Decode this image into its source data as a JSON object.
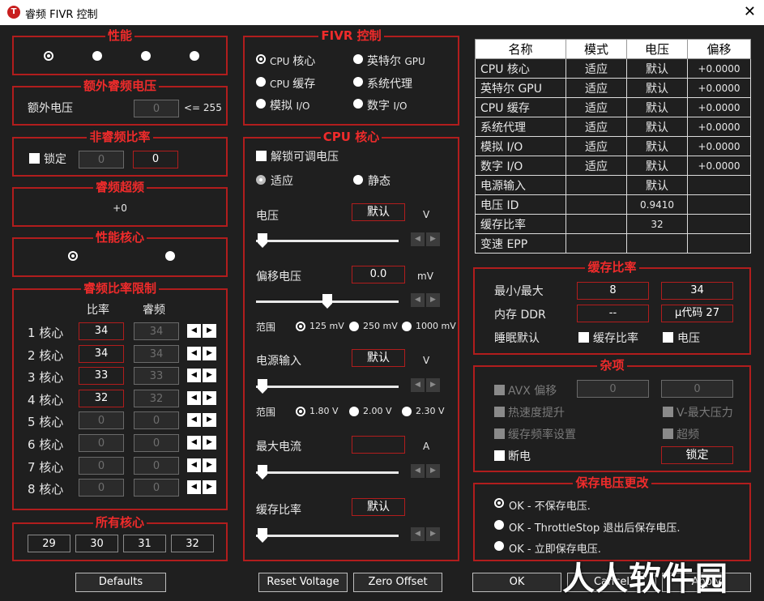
{
  "window": {
    "title": "睿频 FIVR 控制",
    "icon_letter": "T",
    "close_glyph": "✕"
  },
  "performance": {
    "title": "性能"
  },
  "extra_turbo_voltage": {
    "title": "额外睿频电压",
    "label": "额外电压",
    "value": "0",
    "limit": "<= 255"
  },
  "non_turbo_ratio": {
    "title": "非睿频比率",
    "lock_label": "锁定",
    "value1": "0",
    "value2": "0"
  },
  "turbo_boost": {
    "title": "睿频超频",
    "value": "+0"
  },
  "perf_core": {
    "title": "性能核心"
  },
  "turbo_ratio_limit": {
    "title": "睿频比率限制",
    "col_ratio": "比率",
    "col_turbo": "睿频",
    "rows": [
      {
        "label": "1 核心",
        "ratio": "34",
        "turbo": "34"
      },
      {
        "label": "2 核心",
        "ratio": "34",
        "turbo": "34"
      },
      {
        "label": "3 核心",
        "ratio": "33",
        "turbo": "33"
      },
      {
        "label": "4 核心",
        "ratio": "32",
        "turbo": "32"
      },
      {
        "label": "5 核心",
        "ratio": "0",
        "turbo": "0"
      },
      {
        "label": "6 核心",
        "ratio": "0",
        "turbo": "0"
      },
      {
        "label": "7 核心",
        "ratio": "0",
        "turbo": "0"
      },
      {
        "label": "8 核心",
        "ratio": "0",
        "turbo": "0"
      }
    ]
  },
  "all_cores": {
    "title": "所有核心",
    "values": [
      "29",
      "30",
      "31",
      "32"
    ]
  },
  "fivr_control": {
    "title": "FIVR 控制",
    "options": [
      {
        "main": "CPU ",
        "sub": "核心"
      },
      {
        "main": "英特尔 ",
        "sub": "GPU"
      },
      {
        "main": "CPU ",
        "sub": "缓存"
      },
      {
        "main": "系统代理",
        "sub": ""
      },
      {
        "main": "模拟 ",
        "sub": "I/O"
      },
      {
        "main": "数字 ",
        "sub": "I/O"
      }
    ]
  },
  "cpu_core": {
    "title": "CPU 核心",
    "unlock_label": "解锁可调电压",
    "adaptive_label": "适应",
    "static_label": "静态",
    "voltage": {
      "label": "电压",
      "value": "默认",
      "unit": "V",
      "slider_level": 0
    },
    "offset": {
      "label": "偏移电压",
      "value": "0.0",
      "unit": "mV",
      "slider_level": 0.5,
      "range_label": "范围",
      "ranges": [
        "125 mV",
        "250 mV",
        "1000 mV"
      ]
    },
    "power_input": {
      "label": "电源输入",
      "value": "默认",
      "unit": "V",
      "slider_level": 0,
      "range_label": "范围",
      "ranges": [
        "1.80 V",
        "2.00 V",
        "2.30 V"
      ]
    },
    "max_current": {
      "label": "最大电流",
      "value": "",
      "unit": "A",
      "slider_level": 0
    },
    "cache_ratio": {
      "label": "缓存比率",
      "value": "默认",
      "slider_level": 0
    }
  },
  "fivr_table": {
    "headers": [
      "名称",
      "模式",
      "电压",
      "偏移"
    ],
    "rows": [
      {
        "name": "CPU 核心",
        "mode": "适应",
        "voltage": "默认",
        "offset": "+0.0000"
      },
      {
        "name": "英特尔 GPU",
        "mode": "适应",
        "voltage": "默认",
        "offset": "+0.0000"
      },
      {
        "name": "CPU 缓存",
        "mode": "适应",
        "voltage": "默认",
        "offset": "+0.0000"
      },
      {
        "name": "系统代理",
        "mode": "适应",
        "voltage": "默认",
        "offset": "+0.0000"
      },
      {
        "name": "模拟 I/O",
        "mode": "适应",
        "voltage": "默认",
        "offset": "+0.0000"
      },
      {
        "name": "数字 I/O",
        "mode": "适应",
        "voltage": "默认",
        "offset": "+0.0000"
      },
      {
        "name": "电源输入",
        "mode": "",
        "voltage": "默认",
        "offset": ""
      },
      {
        "name": "电压 ID",
        "mode": "",
        "voltage": "0.9410",
        "offset": ""
      },
      {
        "name": "缓存比率",
        "mode": "",
        "voltage": "32",
        "offset": ""
      },
      {
        "name": "变速 EPP",
        "mode": "",
        "voltage": "",
        "offset": ""
      }
    ]
  },
  "cache_ratio_group": {
    "title": "缓存比率",
    "min_max_label": "最小/最大",
    "min_value": "8",
    "max_value": "34",
    "memory_label": "内存 DDR",
    "memory_value": "--",
    "microcode": "μ代码 27",
    "sleep_default_label": "睡眠默认",
    "chk_cache_label": "缓存比率",
    "chk_voltage_label": "电压"
  },
  "misc": {
    "title": "杂项",
    "avx_label": "AVX 偏移",
    "avx_value1": "0",
    "avx_value2": "0",
    "speed_shift_label": "热速度提升",
    "v_max_label": "V-最大压力",
    "cache_freq_label": "缓存频率设置",
    "overclock_label": "超频",
    "power_off_label": "断电",
    "lock_button": "锁定"
  },
  "save_voltage": {
    "title": "保存电压更改",
    "options": [
      "OK - 不保存电压.",
      "OK - ThrottleStop 退出后保存电压.",
      "OK - 立即保存电压."
    ]
  },
  "footer": {
    "defaults": "Defaults",
    "reset_voltage": "Reset Voltage",
    "zero_offset": "Zero Offset",
    "ok": "OK",
    "cancel": "Cancel",
    "apply": "Apply"
  },
  "watermark": "人人软件园"
}
